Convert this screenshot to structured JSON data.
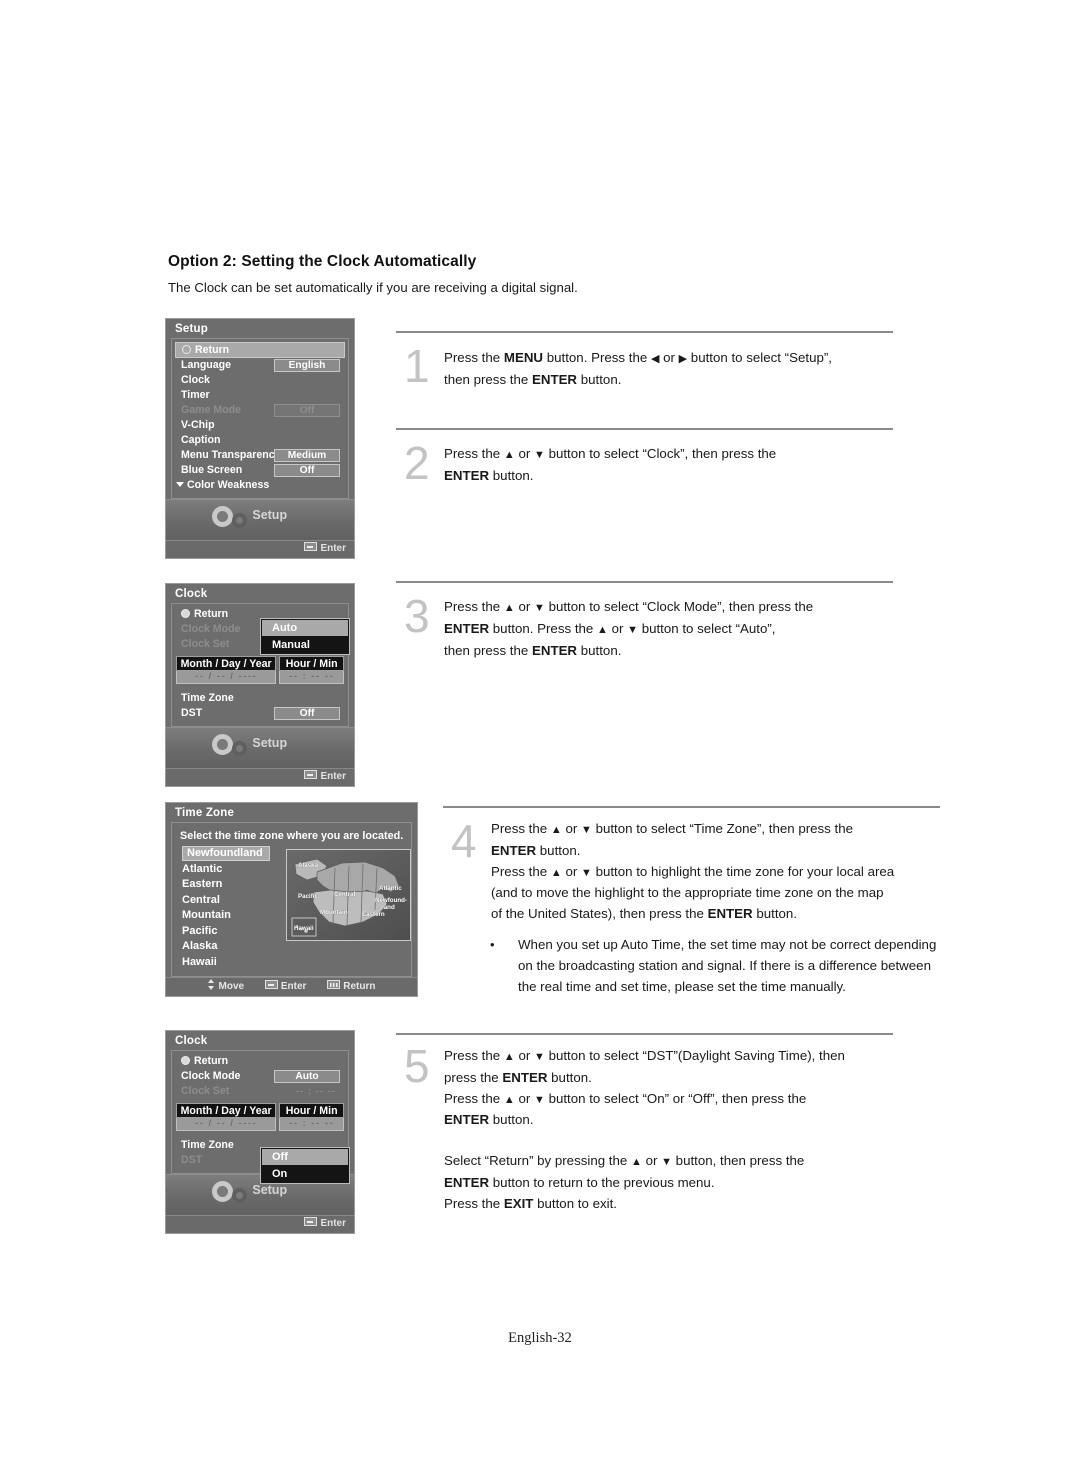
{
  "document": {
    "heading": "Option 2: Setting the Clock Automatically",
    "subtitle": "The Clock can be set automatically if you are receiving a digital signal.",
    "footer": "English-32"
  },
  "steps": [
    {
      "number": "1",
      "lines": [
        "Press the MENU button. Press the ◀ or ▶ button to select “Setup”,",
        "then press the ENTER button."
      ]
    },
    {
      "number": "2",
      "lines": [
        "Press the ▲ or ▼ button to select “Clock”, then press the",
        "ENTER button."
      ]
    },
    {
      "number": "3",
      "lines": [
        "Press the ▲ or ▼ button to select “Clock Mode”, then press the",
        "ENTER button. Press the ▲ or ▼ button to select “Auto”,",
        "then press the ENTER button."
      ]
    },
    {
      "number": "4",
      "lines": [
        "Press the ▲ or ▼ button to select “Time Zone”, then press the",
        "ENTER button.",
        "Press the ▲ or ▼ button to highlight the time zone for your local area",
        "(and to move the highlight to the appropriate time zone on the map",
        "of the United States), then press the ENTER button."
      ]
    },
    {
      "number": "5",
      "lines": [
        "Press the ▲ or ▼ button to select “DST”(Daylight Saving Time), then",
        "press the ENTER button.",
        "Press the ▲ or ▼ button to select “On” or “Off”, then press the",
        "ENTER button.",
        "",
        "Select “Return” by pressing the ▲ or ▼ button, then press the",
        "ENTER button to return to the previous menu.",
        "Press the EXIT button to exit."
      ]
    }
  ],
  "note": {
    "bullet": "•",
    "text": "When you set up Auto Time, the set time may not be correct depending on the broadcasting station and signal. If there is a difference between the real time and set time, please set the time manually."
  },
  "osd_setup": {
    "title": "Setup",
    "return_label": "Return",
    "rows": [
      {
        "label": "Language",
        "value": "English",
        "dim": false
      },
      {
        "label": "Clock",
        "value": "",
        "dim": false
      },
      {
        "label": "Timer",
        "value": "",
        "dim": false
      },
      {
        "label": "Game Mode",
        "value": "Off",
        "dim": true
      },
      {
        "label": "V-Chip",
        "value": "",
        "dim": false
      },
      {
        "label": "Caption",
        "value": "",
        "dim": false
      },
      {
        "label": "Menu Transparency",
        "value": "Medium",
        "dim": false
      },
      {
        "label": "Blue Screen",
        "value": "Off",
        "dim": false
      }
    ],
    "more_label": "Color Weakness",
    "footer_label": "Setup",
    "enter_label": "Enter"
  },
  "osd_clock_mode": {
    "title": "Clock",
    "return_label": "Return",
    "rows": [
      {
        "label": "Clock Mode",
        "dim": true
      },
      {
        "label": "Clock Set",
        "dim": true
      }
    ],
    "popup": {
      "items": [
        "Auto",
        "Manual"
      ],
      "selected": "Auto"
    },
    "date_header": "Month / Day / Year",
    "date_value": "--  /  --  /  ----",
    "time_header": "Hour / Min",
    "time_value": "-- : --   --",
    "time_zone_label": "Time Zone",
    "dst_label": "DST",
    "dst_value": "Off",
    "footer_label": "Setup",
    "enter_label": "Enter"
  },
  "osd_timezone": {
    "title": "Time Zone",
    "instruction": "Select the time zone where you are located.",
    "zones": [
      "Newfoundland",
      "Atlantic",
      "Eastern",
      "Central",
      "Mountain",
      "Pacific",
      "Alaska",
      "Hawaii"
    ],
    "selected_zone": "Newfoundland",
    "map_labels": [
      "Alaska",
      "Pacific",
      "Central",
      "Atlantic",
      "Newfound-",
      "land",
      "Mountain",
      "Eastern",
      "Hawaii"
    ],
    "footer": {
      "move_label": "Move",
      "enter_label": "Enter",
      "return_label": "Return"
    }
  },
  "osd_dst": {
    "title": "Clock",
    "return_label": "Return",
    "clock_mode_label": "Clock Mode",
    "clock_mode_value": "Auto",
    "clock_set_label": "Clock Set",
    "clock_set_value": "-- : --   --",
    "date_header": "Month / Day / Year",
    "date_value": "--  /  --  /  ----",
    "time_header": "Hour / Min",
    "time_value": "-- : --   --",
    "time_zone_label": "Time Zone",
    "dst_label": "DST",
    "popup": {
      "items": [
        "Off",
        "On"
      ],
      "selected": "Off"
    },
    "footer_label": "Setup",
    "enter_label": "Enter"
  },
  "colors": {
    "osd_bg": "#6d6d6d",
    "osd_highlight": "#a9a9a9",
    "popup_bg": "#141414",
    "step_number": "#c3c3c3",
    "rule": "#8a8a8a"
  }
}
